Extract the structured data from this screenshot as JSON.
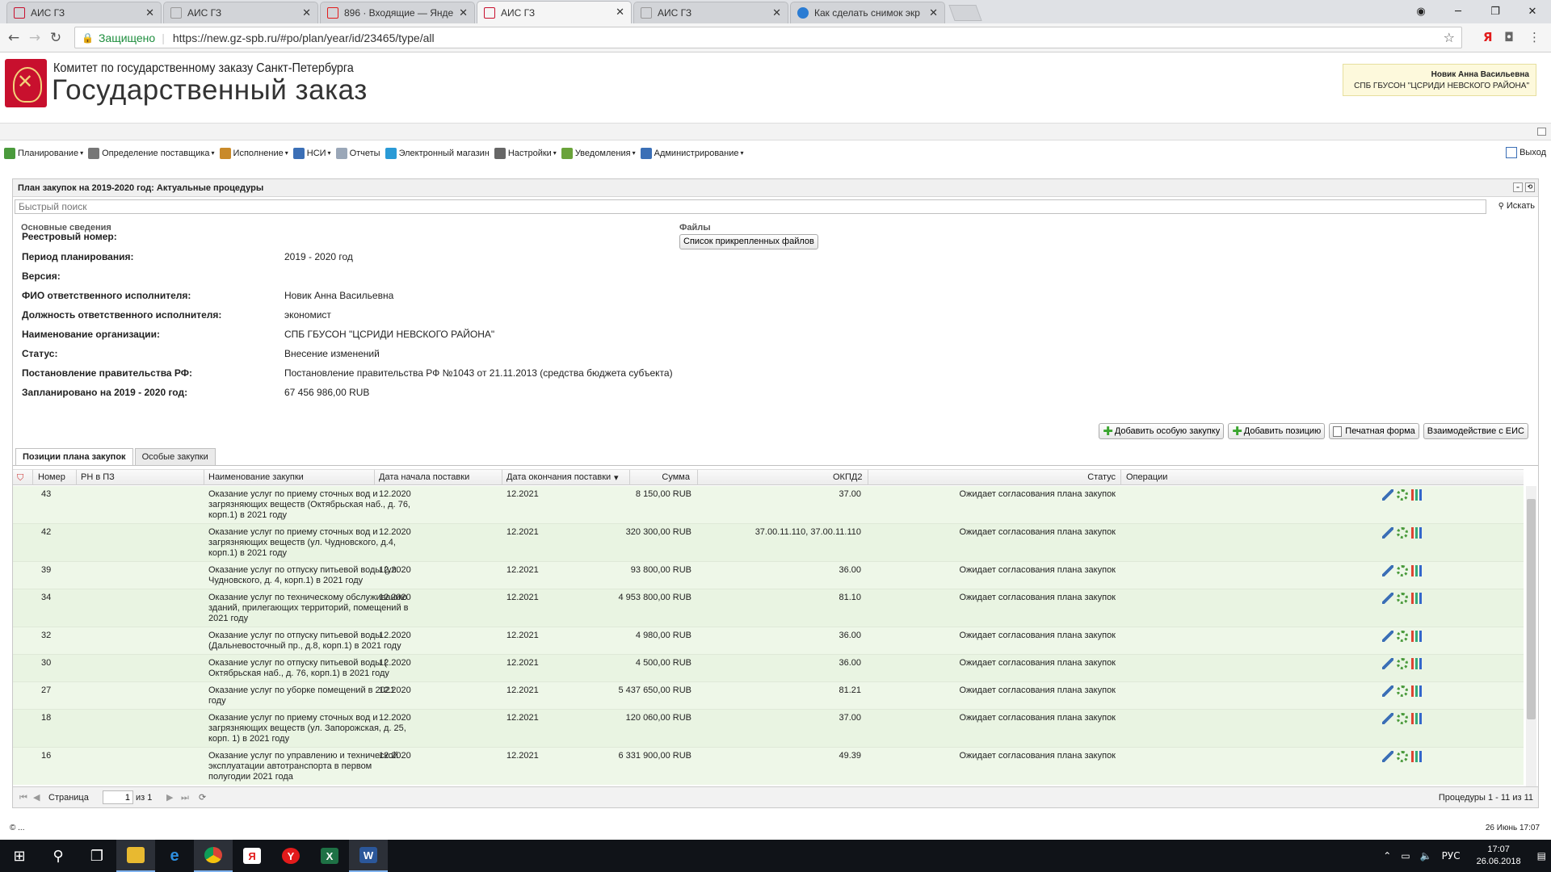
{
  "browser": {
    "tabs": [
      {
        "title": "АИС ГЗ",
        "icon": "ais-favicon",
        "active": false
      },
      {
        "title": "АИС ГЗ",
        "icon": "page-icon",
        "active": false
      },
      {
        "title": "896 · Входящие — Янде",
        "icon": "yandex-mail-icon",
        "active": false
      },
      {
        "title": "АИС ГЗ",
        "icon": "ais-favicon",
        "active": true
      },
      {
        "title": "АИС ГЗ",
        "icon": "page-icon",
        "active": false
      },
      {
        "title": "Как сделать снимок экр",
        "icon": "edge-icon",
        "active": false
      }
    ],
    "close_glyph": "✕",
    "secure_label": "Защищено",
    "url": "https://new.gz-spb.ru/#po/plan/year/id/23465/type/all",
    "ext_ya": "Я"
  },
  "header": {
    "org_line": "Комитет по государственному заказу Санкт-Петербурга",
    "brand": "Государственный заказ",
    "user_name": "Новик Анна Васильевна",
    "user_org": "СПБ ГБУСОН \"ЦСРИДИ НЕВСКОГО РАЙОНА\""
  },
  "menu": {
    "items": [
      {
        "label": "Планирование",
        "icon": "planning-icon",
        "color": "#4a9a3c",
        "dropdown": true
      },
      {
        "label": "Определение поставщика",
        "icon": "supplier-icon",
        "color": "#777777",
        "dropdown": true
      },
      {
        "label": "Исполнение",
        "icon": "execution-icon",
        "color": "#c98a2a",
        "dropdown": true
      },
      {
        "label": "НСИ",
        "icon": "nsi-icon",
        "color": "#3b6fb6",
        "dropdown": true
      },
      {
        "label": "Отчеты",
        "icon": "reports-icon",
        "color": "#9aa7b8",
        "dropdown": false
      },
      {
        "label": "Электронный магазин",
        "icon": "shop-icon",
        "color": "#2a9ad6",
        "dropdown": false
      },
      {
        "label": "Настройки",
        "icon": "settings-icon",
        "color": "#666666",
        "dropdown": true
      },
      {
        "label": "Уведомления",
        "icon": "notifications-icon",
        "color": "#6aa33a",
        "dropdown": true
      },
      {
        "label": "Администрирование",
        "icon": "admin-icon",
        "color": "#3b6fb6",
        "dropdown": true
      }
    ],
    "logout": "Выход"
  },
  "panel": {
    "title": "План закупок на 2019-2020 год: Актуальные процедуры",
    "search_placeholder": "Быстрый поиск",
    "search_button": "Искать",
    "section_main": "Основные сведения",
    "section_files": "Файлы",
    "files_button": "Список прикрепленных файлов",
    "fields": [
      {
        "label": "Реестровый номер:",
        "value": ""
      },
      {
        "label": "Период планирования:",
        "value": "2019 - 2020 год"
      },
      {
        "label": "Версия:",
        "value": ""
      },
      {
        "label": "ФИО ответственного исполнителя:",
        "value": "Новик Анна Васильевна"
      },
      {
        "label": "Должность ответственного исполнителя:",
        "value": "экономист"
      },
      {
        "label": "Наименование организации:",
        "value": "СПБ ГБУСОН \"ЦСРИДИ НЕВСКОГО РАЙОНА\""
      },
      {
        "label": "Статус:",
        "value": "Внесение изменений"
      },
      {
        "label": "Постановление правительства РФ:",
        "value": "Постановление правительства РФ №1043 от 21.11.2013 (средства бюджета субъекта)"
      },
      {
        "label": "Запланировано на 2019 - 2020 год:",
        "value": "67 456 986,00 RUB"
      }
    ],
    "actions": {
      "add_special": "Добавить особую закупку",
      "add_position": "Добавить позицию",
      "print": "Печатная форма",
      "eis": "Взаимодействие с ЕИС"
    },
    "tabs": [
      "Позиции плана закупок",
      "Особые закупки"
    ]
  },
  "grid": {
    "columns": [
      "Номер",
      "РН в ПЗ",
      "Наименование закупки",
      "Дата начала поставки",
      "Дата окончания поставки",
      "Сумма",
      "ОКПД2",
      "Статус",
      "Операции"
    ],
    "rows": [
      {
        "num": "43",
        "rn": "",
        "name": "Оказание услуг по приему сточных вод и загрязняющих веществ (Октябрьская наб., д. 76, корп.1) в 2021 году",
        "start": "12.2020",
        "end": "12.2021",
        "sum": "8 150,00 RUB",
        "okpd": "37.00",
        "status": "Ожидает согласования плана закупок"
      },
      {
        "num": "42",
        "rn": "",
        "name": "Оказание услуг по приему сточных вод и загрязняющих веществ (ул. Чудновского, д.4, корп.1) в 2021 году",
        "start": "12.2020",
        "end": "12.2021",
        "sum": "320 300,00 RUB",
        "okpd": "37.00.11.110, 37.00.11.110",
        "status": "Ожидает согласования плана закупок"
      },
      {
        "num": "39",
        "rn": "",
        "name": "Оказание услуг по отпуску питьевой воды (ул. Чудновского, д. 4, корп.1) в 2021 году",
        "start": "12.2020",
        "end": "12.2021",
        "sum": "93 800,00 RUB",
        "okpd": "36.00",
        "status": "Ожидает согласования плана закупок"
      },
      {
        "num": "34",
        "rn": "",
        "name": "Оказание услуг по техническому обслуживанию зданий, прилегающих территорий, помещений в 2021 году",
        "start": "12.2020",
        "end": "12.2021",
        "sum": "4 953 800,00 RUB",
        "okpd": "81.10",
        "status": "Ожидает согласования плана закупок"
      },
      {
        "num": "32",
        "rn": "",
        "name": "Оказание услуг по отпуску питьевой воды (Дальневосточный пр., д.8, корп.1) в 2021 году",
        "start": "12.2020",
        "end": "12.2021",
        "sum": "4 980,00 RUB",
        "okpd": "36.00",
        "status": "Ожидает согласования плана закупок"
      },
      {
        "num": "30",
        "rn": "",
        "name": "Оказание услуг по отпуску питьевой воды ( Октябрьская наб., д. 76, корп.1) в 2021 году",
        "start": "12.2020",
        "end": "12.2021",
        "sum": "4 500,00 RUB",
        "okpd": "36.00",
        "status": "Ожидает согласования плана закупок"
      },
      {
        "num": "27",
        "rn": "",
        "name": "Оказание услуг по уборке помещений в 2021 году",
        "start": "12.2020",
        "end": "12.2021",
        "sum": "5 437 650,00 RUB",
        "okpd": "81.21",
        "status": "Ожидает согласования плана закупок"
      },
      {
        "num": "18",
        "rn": "",
        "name": "Оказание услуг по приему сточных вод и загрязняющих веществ (ул. Запорожская, д. 25, корп. 1) в 2021 году",
        "start": "12.2020",
        "end": "12.2021",
        "sum": "120 060,00 RUB",
        "okpd": "37.00",
        "status": "Ожидает согласования плана закупок"
      },
      {
        "num": "16",
        "rn": "",
        "name": "Оказание услуг по управлению и технической эксплуатации автотранспорта в первом полугодии 2021 года",
        "start": "12.2020",
        "end": "12.2021",
        "sum": "6 331 900,00 RUB",
        "okpd": "49.39",
        "status": "Ожидает согласования плана закупок"
      }
    ],
    "pager": {
      "page_label": "Страница",
      "page_value": "1",
      "of_label": "из 1",
      "summary": "Процедуры 1 - 11 из 11"
    }
  },
  "status_bar": {
    "left": "© ...",
    "right": "26 Июнь 17:07"
  },
  "taskbar": {
    "apps": [
      "windows-start-icon",
      "search-icon",
      "task-view-icon",
      "explorer-icon",
      "ie-icon",
      "chrome-icon",
      "yandex-icon",
      "yandex-browser-icon",
      "excel-icon",
      "word-icon"
    ],
    "lang": "РУС",
    "time": "17:07",
    "date": "26.06.2018"
  }
}
